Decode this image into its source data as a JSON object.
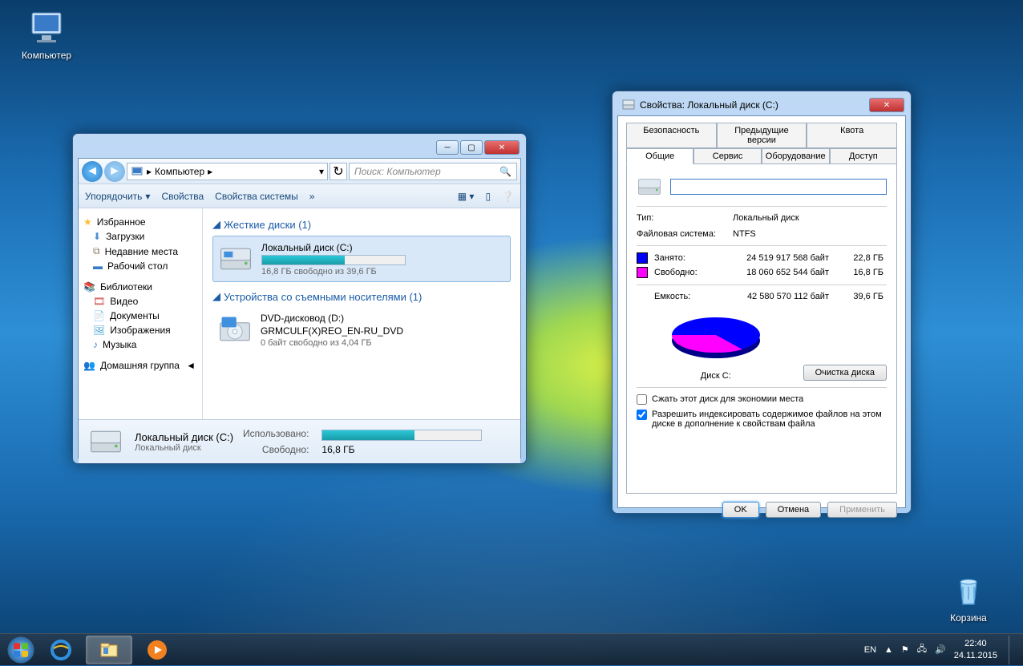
{
  "desktop": {
    "computer": "Компьютер",
    "recycle": "Корзина"
  },
  "explorer": {
    "breadcrumb": "Компьютер",
    "search_placeholder": "Поиск: Компьютер",
    "toolbar": {
      "organize": "Упорядочить",
      "properties": "Свойства",
      "system_properties": "Свойства системы"
    },
    "sidebar": {
      "favorites": "Избранное",
      "downloads": "Загрузки",
      "recent": "Недавние места",
      "desktop": "Рабочий стол",
      "libraries": "Библиотеки",
      "videos": "Видео",
      "documents": "Документы",
      "pictures": "Изображения",
      "music": "Музыка",
      "homegroup": "Домашняя группа"
    },
    "groups": {
      "hdd": "Жесткие диски (1)",
      "removable": "Устройства со съемными носителями (1)"
    },
    "drive_c": {
      "name": "Локальный диск (C:)",
      "sub": "16,8 ГБ свободно из 39,6 ГБ",
      "fill_pct": 58
    },
    "drive_d": {
      "name": "DVD-дисковод (D:)",
      "label": "GRMCULF(X)REO_EN-RU_DVD",
      "sub": "0 байт свободно из 4,04 ГБ"
    },
    "details": {
      "title": "Локальный диск (C:)",
      "type": "Локальный диск",
      "used_label": "Использовано:",
      "free_label": "Свободно:",
      "free_value": "16,8 ГБ"
    }
  },
  "props": {
    "title": "Свойства: Локальный диск (C:)",
    "tabs": {
      "security": "Безопасность",
      "prev_versions": "Предыдущие версии",
      "quota": "Квота",
      "general": "Общие",
      "service": "Сервис",
      "hardware": "Оборудование",
      "access": "Доступ"
    },
    "type_label": "Тип:",
    "type_value": "Локальный диск",
    "fs_label": "Файловая система:",
    "fs_value": "NTFS",
    "used_label": "Занято:",
    "used_bytes": "24 519 917 568 байт",
    "used_gb": "22,8 ГБ",
    "free_label": "Свободно:",
    "free_bytes": "18 060 652 544 байт",
    "free_gb": "16,8 ГБ",
    "capacity_label": "Емкость:",
    "capacity_bytes": "42 580 570 112 байт",
    "capacity_gb": "39,6 ГБ",
    "disk_label": "Диск C:",
    "cleanup": "Очистка диска",
    "compress": "Сжать этот диск для экономии места",
    "index": "Разрешить индексировать содержимое файлов на этом диске в дополнение к свойствам файла",
    "ok": "OK",
    "cancel": "Отмена",
    "apply": "Применить"
  },
  "taskbar": {
    "lang": "EN",
    "time": "22:40",
    "date": "24.11.2015"
  },
  "chart_data": {
    "type": "pie",
    "title": "Диск C:",
    "series": [
      {
        "name": "Занято",
        "value": 24519917568,
        "value_gb": 22.8,
        "color": "#0000ff"
      },
      {
        "name": "Свободно",
        "value": 18060652544,
        "value_gb": 16.8,
        "color": "#ff00ff"
      }
    ],
    "total": 42580570112,
    "total_gb": 39.6
  }
}
